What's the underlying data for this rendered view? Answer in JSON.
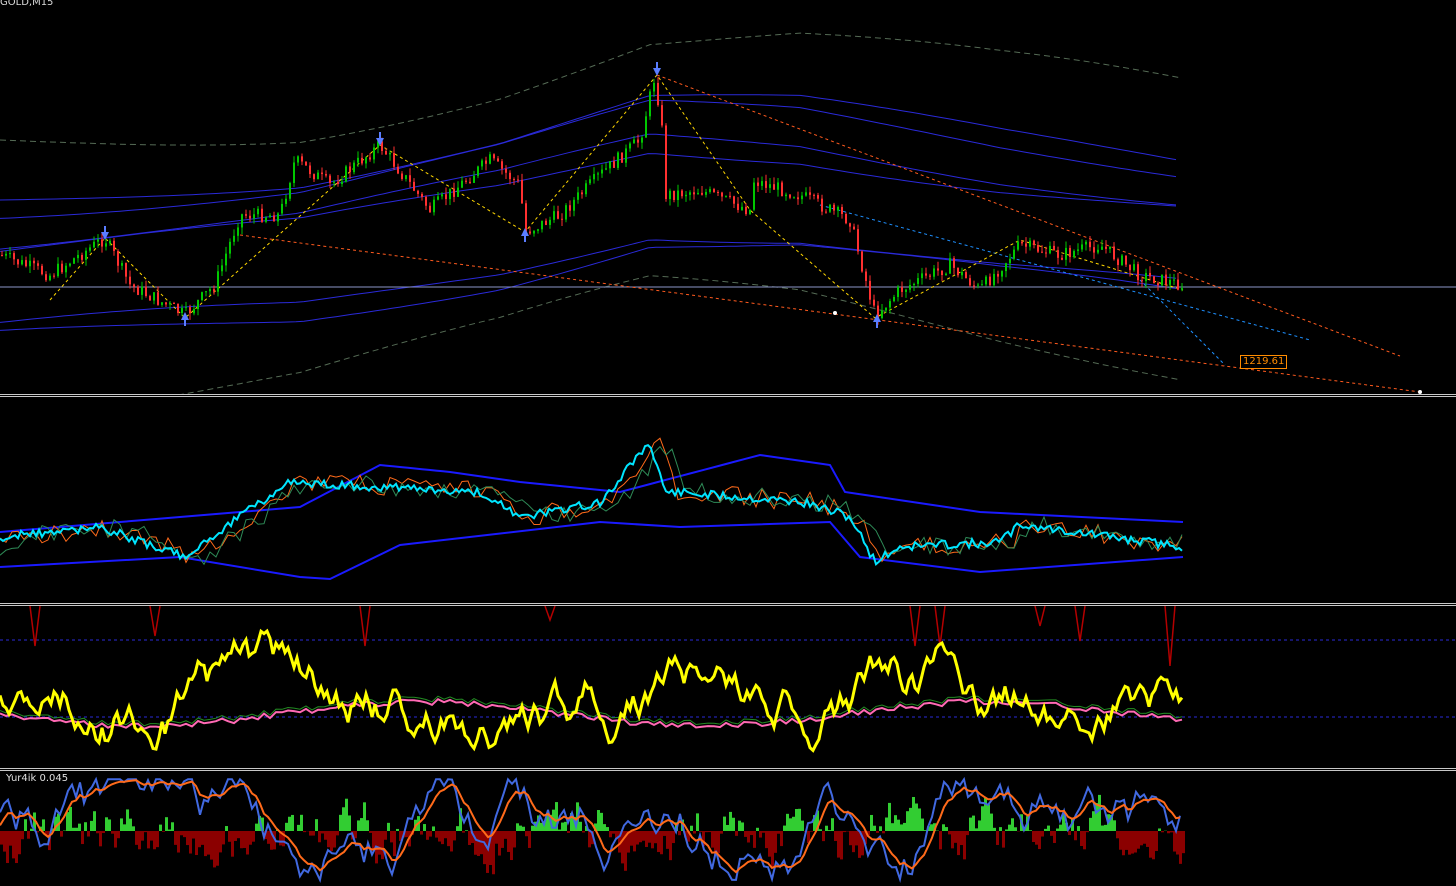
{
  "main_pane": {
    "symbol_label": "GOLD,M15",
    "price_level_label": "1219.61",
    "colors": {
      "bull_candle": "#00c800",
      "bear_candle": "#ff3030",
      "envelope": "#2a2ad8",
      "zigzag": "#ffd700",
      "trendline": "#ff5a1e",
      "trendline_blue": "#1e90ff",
      "arrow": "#5a7dff",
      "hline": "#8c96c8"
    }
  },
  "oscillator_pane_1": {
    "colors": {
      "main": "#00e5ff",
      "band": "#1a1aff"
    }
  },
  "oscillator_pane_2": {
    "colors": {
      "main": "#ffff00",
      "signal": "#ff69b4",
      "spike": "#b40000"
    }
  },
  "oscillator_pane_3": {
    "indicator_label": "Yur4ik 0.045",
    "colors": {
      "pos_hist": "#32cd32",
      "neg_hist": "#8b0000",
      "line_a": "#4169e1",
      "line_b": "#ff6a1a"
    }
  }
}
